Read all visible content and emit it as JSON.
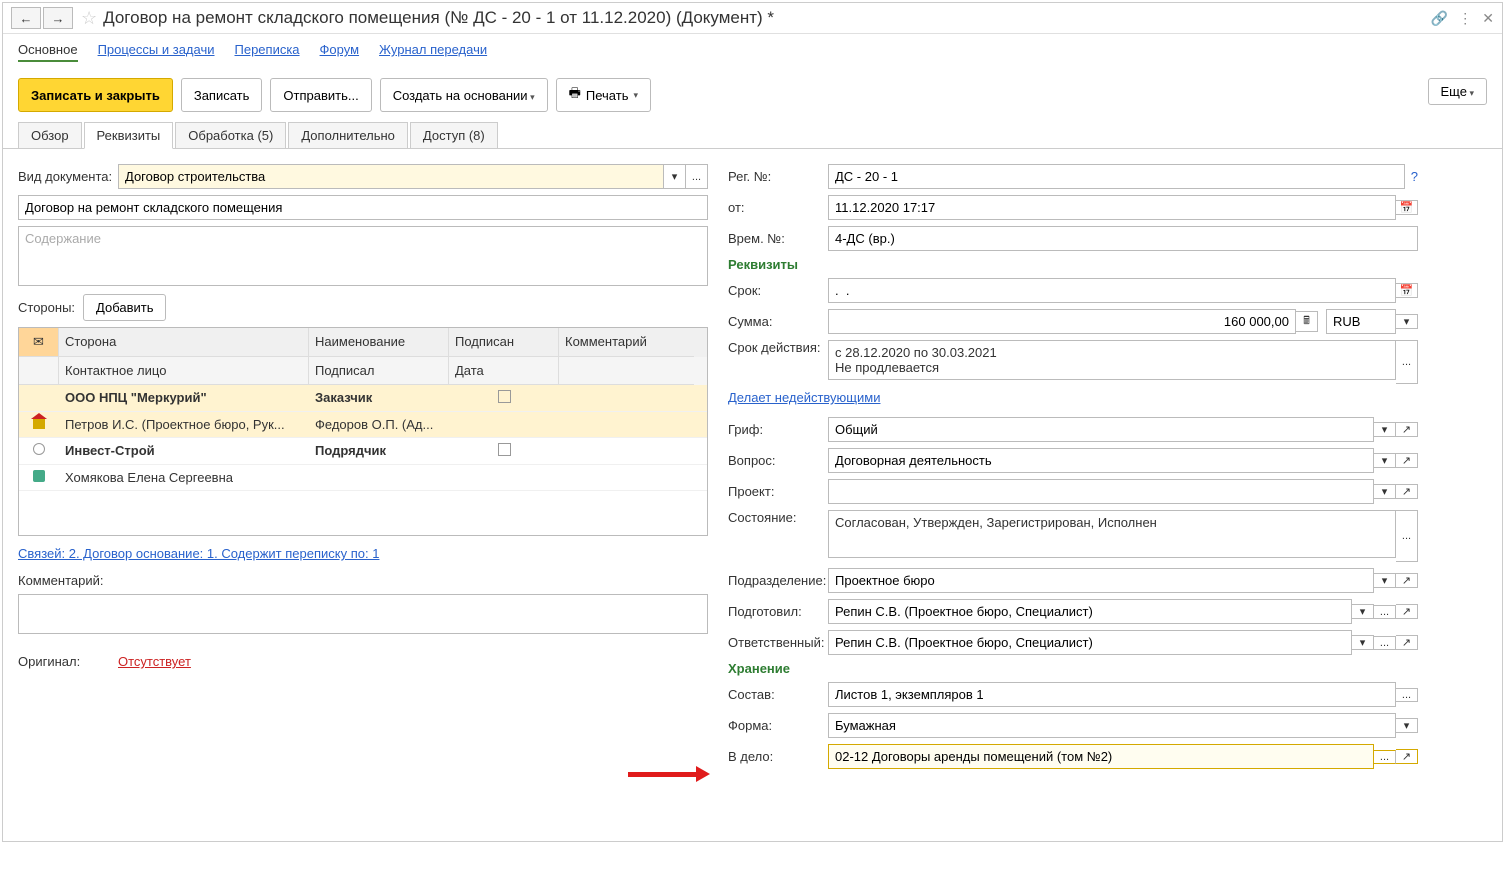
{
  "title": "Договор на ремонт складского помещения (№ ДС - 20 - 1 от 11.12.2020) (Документ) *",
  "nav": {
    "main": "Основное",
    "processes": "Процессы и задачи",
    "correspondence": "Переписка",
    "forum": "Форум",
    "journal": "Журнал передачи"
  },
  "toolbar": {
    "save_close": "Записать и закрыть",
    "save": "Записать",
    "send": "Отправить...",
    "create_based": "Создать на основании",
    "print": "Печать",
    "more": "Еще"
  },
  "tabs2": {
    "overview": "Обзор",
    "details": "Реквизиты",
    "processing": "Обработка (5)",
    "additional": "Дополнительно",
    "access": "Доступ (8)"
  },
  "left": {
    "doc_type_label": "Вид документа:",
    "doc_type_value": "Договор строительства",
    "name_value": "Договор на ремонт складского помещения",
    "content_placeholder": "Содержание",
    "sides_label": "Стороны:",
    "add_button": "Добавить",
    "table_headers": {
      "side": "Сторона",
      "name": "Наименование",
      "signed": "Подписан",
      "comment": "Комментарий",
      "contact": "Контактное лицо",
      "signed_by": "Подписал",
      "date": "Дата"
    },
    "rows": [
      {
        "side": "ООО НПЦ \"Меркурий\"",
        "name": "Заказчик",
        "signed": "",
        "bold": true,
        "sel": true,
        "icon": null
      },
      {
        "side": "Петров И.С. (Проектное бюро, Рук...",
        "name": "Федоров О.П. (Ад...",
        "signed": "",
        "bold": false,
        "sel": true,
        "icon": "hut"
      },
      {
        "side": "Инвест-Строй",
        "name": "Подрядчик",
        "signed": "",
        "bold": true,
        "sel": false,
        "icon": "radio"
      },
      {
        "side": "Хомякова Елена Сергеевна",
        "name": "",
        "signed": "",
        "bold": false,
        "sel": false,
        "icon": "person"
      }
    ],
    "links_line": "Связей: 2. Договор основание: 1. Содержит переписку по: 1",
    "comment_label": "Комментарий:",
    "original_label": "Оригинал:",
    "original_value": "Отсутствует"
  },
  "right": {
    "reg_no_label": "Рег. №:",
    "reg_no_value": "ДС - 20 - 1",
    "from_label": "от:",
    "from_value": "11.12.2020 17:17",
    "temp_no_label": "Врем. №:",
    "temp_no_value": "4-ДС (вр.)",
    "section_rekv": "Реквизиты",
    "term_label": "Срок:",
    "term_value": ".  .",
    "sum_label": "Сумма:",
    "sum_value": "160 000,00",
    "currency": "RUB",
    "valid_label": "Срок действия:",
    "valid_value": "с 28.12.2020 по 30.03.2021\nНе продлевается",
    "invalid_link": "Делает недействующими",
    "grif_label": "Гриф:",
    "grif_value": "Общий",
    "question_label": "Вопрос:",
    "question_value": "Договорная деятельность",
    "project_label": "Проект:",
    "project_value": "",
    "state_label": "Состояние:",
    "state_value": "Согласован, Утвержден, Зарегистрирован, Исполнен",
    "dept_label": "Подразделение:",
    "dept_value": "Проектное бюро",
    "prepared_label": "Подготовил:",
    "prepared_value": "Репин С.В. (Проектное бюро, Специалист)",
    "resp_label": "Ответственный:",
    "resp_value": "Репин С.В. (Проектное бюро, Специалист)",
    "section_storage": "Хранение",
    "comp_label": "Состав:",
    "comp_value": "Листов 1, экземпляров 1",
    "form_label": "Форма:",
    "form_value": "Бумажная",
    "case_label": "В дело:",
    "case_value": "02-12 Договоры аренды помещений (том №2)"
  }
}
